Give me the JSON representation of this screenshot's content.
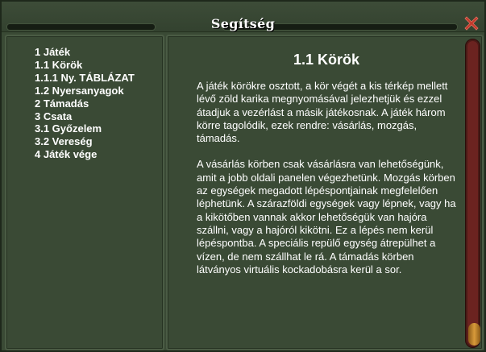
{
  "window": {
    "title": "Segítség"
  },
  "toc": {
    "items": [
      {
        "label": "1 Játék"
      },
      {
        "label": "1.1 Körök"
      },
      {
        "label": "1.1.1 Ny. TÁBLÁZAT"
      },
      {
        "label": "1.2 Nyersanyagok"
      },
      {
        "label": "2 Támadás"
      },
      {
        "label": "3 Csata"
      },
      {
        "label": "3.1 Győzelem"
      },
      {
        "label": "3.2 Vereség"
      },
      {
        "label": "4 Játék vége"
      }
    ]
  },
  "content": {
    "heading": "1.1 Körök",
    "paragraphs": [
      "A játék körökre osztott, a kör végét a kis térkép mellett lévő zöld karika megnyomásával jelezhetjük és ezzel átadjuk a vezérlást a másik játékosnak. A  játék három körre tagolódik, ezek rendre: vásárlás, mozgás, támadás.",
      "A vásárlás körben csak vásárlásra van lehetőségünk, amit a jobb oldali panelen végezhetünk. Mozgás körben az egységek megadott lépéspontjainak megfelelően léphetünk. A szárazföldi egységek vagy lépnek, vagy ha a kikötőben vannak akkor lehetőségük van hajóra szállni, vagy a hajóról kikötni. Ez a lépés nem kerül lépéspontba. A speciális repülő egység átrepülhet a vízen, de nem szállhat le rá. A támadás körben látványos virtuális kockadobásra kerül a sor."
    ]
  },
  "colors": {
    "panel_bg": "#3a4a35",
    "close_accent": "#c0392b",
    "scrollbar_track": "#6b2320",
    "scrollbar_thumb": "#d89a3a"
  },
  "icons": {
    "close": "close-icon"
  }
}
